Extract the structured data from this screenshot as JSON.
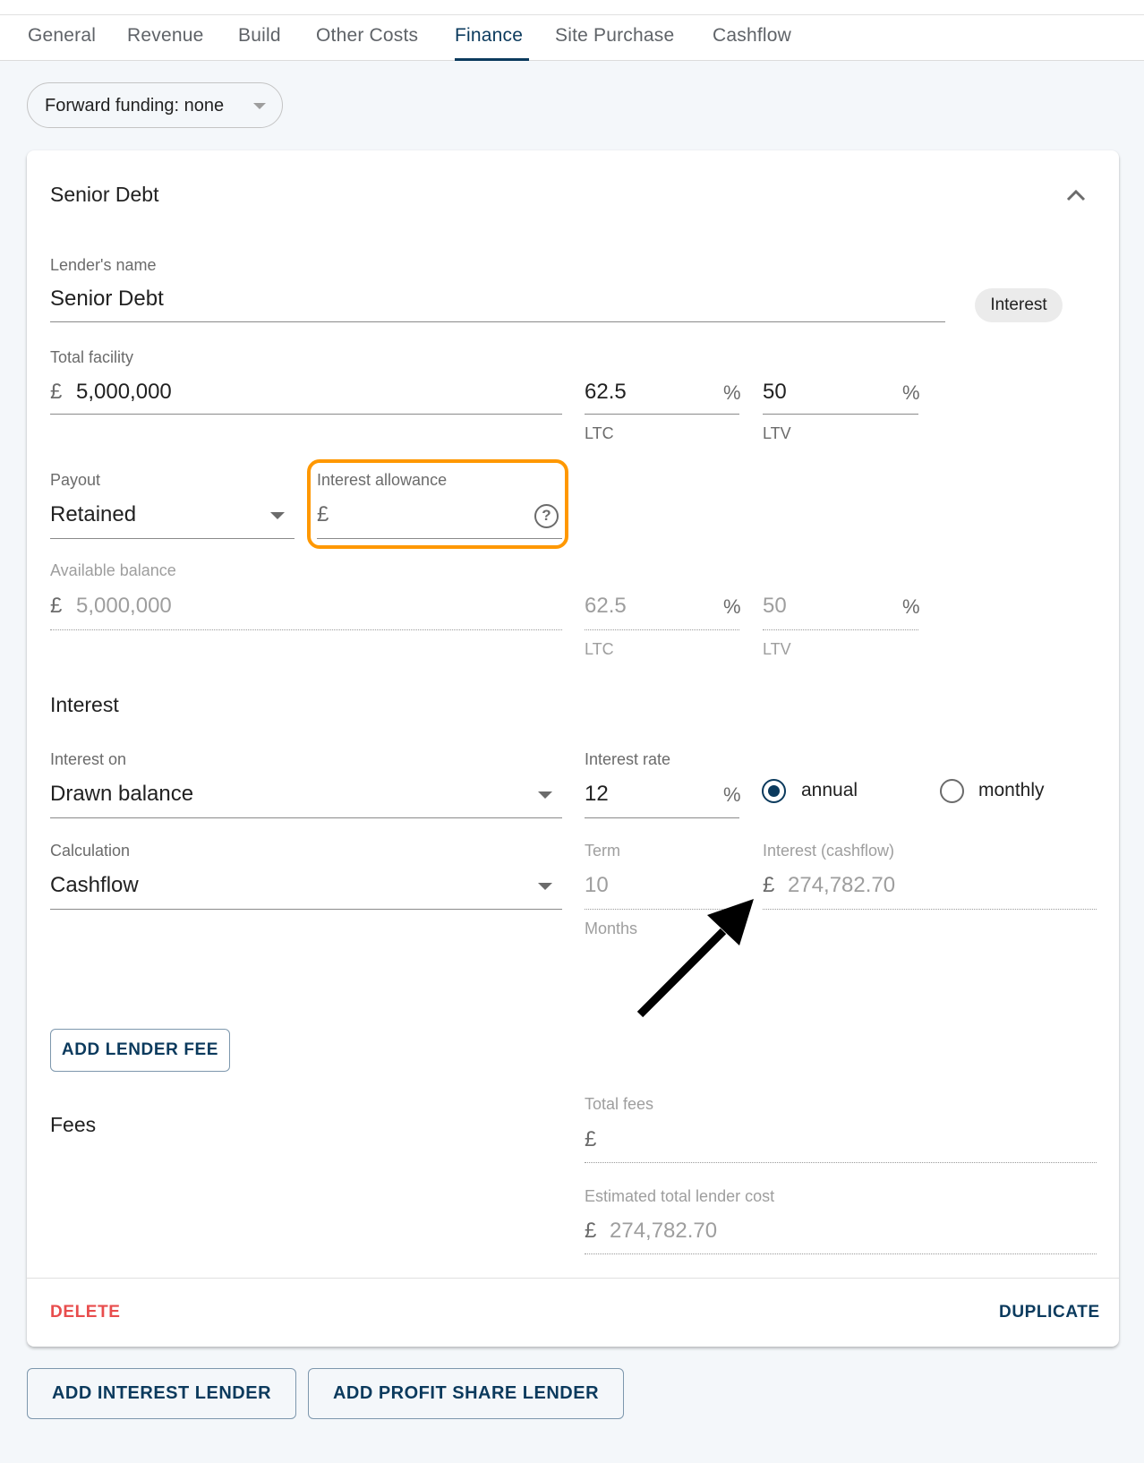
{
  "tabs": [
    {
      "label": "General",
      "active": false
    },
    {
      "label": "Revenue",
      "active": false
    },
    {
      "label": "Build",
      "active": false
    },
    {
      "label": "Other Costs",
      "active": false
    },
    {
      "label": "Finance",
      "active": true
    },
    {
      "label": "Site Purchase",
      "active": false
    },
    {
      "label": "Cashflow",
      "active": false
    }
  ],
  "forward_funding": {
    "label": "Forward funding: none"
  },
  "lender_card": {
    "title": "Senior Debt",
    "type_chip": "Interest",
    "lender_name": {
      "label": "Lender's name",
      "value": "Senior Debt"
    },
    "total_facility": {
      "label": "Total facility",
      "currency": "£",
      "value": "5,000,000"
    },
    "ltc": {
      "value": "62.5",
      "suffix": "%",
      "helper": "LTC"
    },
    "ltv": {
      "value": "50",
      "suffix": "%",
      "helper": "LTV"
    },
    "payout": {
      "label": "Payout",
      "value": "Retained"
    },
    "interest_allowance": {
      "label": "Interest allowance",
      "currency": "£",
      "value": "",
      "highlight_color": "#ff9800"
    },
    "available_balance": {
      "label": "Available balance",
      "currency": "£",
      "value": "5,000,000"
    },
    "available_ltc": {
      "value": "62.5",
      "suffix": "%",
      "helper": "LTC"
    },
    "available_ltv": {
      "value": "50",
      "suffix": "%",
      "helper": "LTV"
    },
    "interest_section": {
      "title": "Interest",
      "interest_on": {
        "label": "Interest on",
        "value": "Drawn balance"
      },
      "interest_rate": {
        "label": "Interest rate",
        "value": "12",
        "suffix": "%"
      },
      "rate_period": {
        "options": [
          "annual",
          "monthly"
        ],
        "selected": "annual"
      },
      "calculation": {
        "label": "Calculation",
        "value": "Cashflow"
      },
      "term": {
        "label": "Term",
        "value": "10",
        "helper": "Months"
      },
      "interest_cashflow": {
        "label": "Interest (cashflow)",
        "currency": "£",
        "value": "274,782.70"
      }
    },
    "fees_section": {
      "title": "Fees",
      "add_fee_label": "ADD LENDER FEE",
      "total_fees": {
        "label": "Total fees",
        "currency": "£",
        "value": ""
      },
      "estimated_total_lender_cost": {
        "label": "Estimated total lender cost",
        "currency": "£",
        "value": "274,782.70"
      }
    },
    "delete_label": "DELETE",
    "duplicate_label": "DUPLICATE"
  },
  "actions": {
    "add_interest_lender": "ADD INTEREST LENDER",
    "add_profit_share_lender": "ADD PROFIT SHARE LENDER"
  },
  "colors": {
    "primary": "#0b3a5d",
    "danger": "#e84d4d",
    "highlight": "#ff9800",
    "background": "#f4f7fa"
  }
}
